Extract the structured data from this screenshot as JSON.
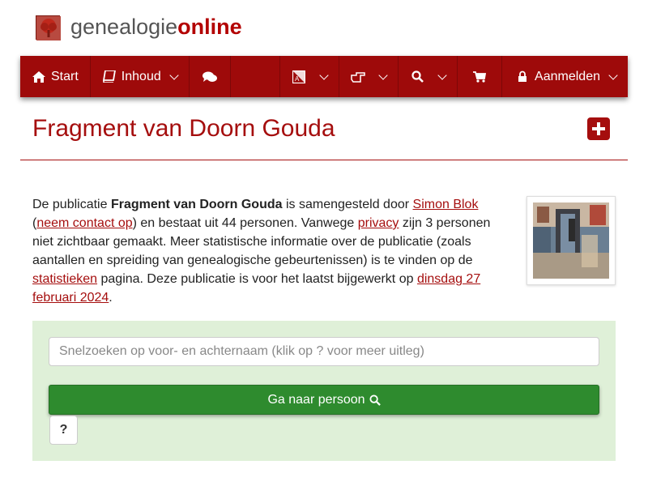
{
  "logo": {
    "part1": "genealogie",
    "part2": "online"
  },
  "nav": {
    "start": "Start",
    "contents": "Inhoud",
    "login": "Aanmelden"
  },
  "page": {
    "title": "Fragment van Doorn Gouda"
  },
  "description": {
    "t1": "De publicatie ",
    "pub_name": "Fragment van Doorn Gouda",
    "t2": " is samengesteld door ",
    "author": "Simon Blok",
    "t3": "(",
    "contact": "neem contact op",
    "t4": ") en bestaat uit 44 personen. Vanwege ",
    "privacy": "privacy",
    "t5": " zijn 3 personen niet zichtbaar gemaakt. Meer statistische informatie over de publicatie (zoals aantallen en spreiding van genealogische gebeurtenissen) is te vinden op de ",
    "stats": "statistieken",
    "t6": " pagina. Deze publicatie is voor het laatst bijgewerkt op ",
    "date": "dinsdag 27 februari 2024",
    "t7": "."
  },
  "search": {
    "placeholder": "Snelzoeken op voor- en achternaam (klik op ? voor meer uitleg)",
    "button": "Ga naar persoon",
    "help": "?"
  },
  "colors": {
    "brand": "#9e0a0a",
    "panel": "#dff0d8",
    "go": "#2e8b2e"
  },
  "icons": [
    "tree-icon",
    "home-icon",
    "book-icon",
    "chat-icon",
    "language-icon",
    "hand-pointer-icon",
    "search-icon",
    "cart-icon",
    "lock-icon",
    "plus-square-icon"
  ]
}
